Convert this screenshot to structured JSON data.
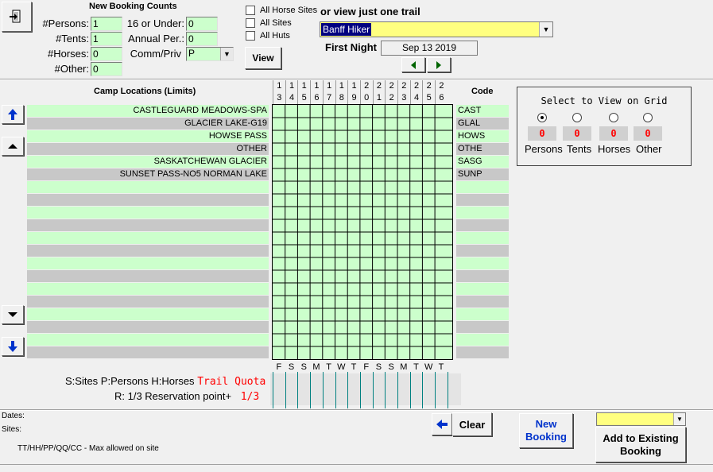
{
  "toolbar": {
    "exit_icon": "exit-door-icon"
  },
  "booking_counts": {
    "title": "New Booking Counts",
    "persons_label": "#Persons:",
    "persons_value": "1",
    "tents_label": "#Tents:",
    "tents_value": "1",
    "horses_label": "#Horses:",
    "horses_value": "0",
    "other_label": "#Other:",
    "other_value": "0",
    "under16_label": "16 or Under:",
    "under16_value": "0",
    "annual_label": "Annual Per.:",
    "annual_value": "0",
    "comm_label": "Comm/Priv",
    "comm_value": "P"
  },
  "filters": {
    "all_horse_sites": "All Horse Sites",
    "all_sites": "All Sites",
    "all_huts": "All Huts",
    "view_button": "View"
  },
  "trail": {
    "title": "or view just one trail",
    "selected": "Banff Hiker",
    "first_night_label": "First Night",
    "first_night_value": "Sep 13 2019"
  },
  "grid": {
    "locations_header": "Camp Locations (Limits)",
    "code_header": "Code",
    "locations": [
      "CASTLEGUARD MEADOWS-SPA",
      "GLACIER LAKE-G19",
      "HOWSE PASS",
      "OTHER",
      "SASKATCHEWAN GLACIER",
      "SUNSET PASS-NO5 NORMAN LAKE"
    ],
    "codes": [
      "CAST",
      "GLAL",
      "HOWS",
      "OTHE",
      "SASG",
      "SUNP"
    ],
    "day_tens": [
      "1",
      "1",
      "1",
      "1",
      "1",
      "1",
      "1",
      "2",
      "2",
      "2",
      "2",
      "2",
      "2",
      "2"
    ],
    "day_ones": [
      "3",
      "4",
      "5",
      "6",
      "7",
      "8",
      "9",
      "0",
      "1",
      "2",
      "3",
      "4",
      "5",
      "6"
    ],
    "weekdays": [
      "F",
      "S",
      "S",
      "M",
      "T",
      "W",
      "T",
      "F",
      "S",
      "S",
      "M",
      "T",
      "W",
      "T"
    ]
  },
  "view_panel": {
    "title": "Select to View on Grid",
    "options": [
      "Persons",
      "Tents",
      "Horses",
      "Other"
    ],
    "counts": [
      "0",
      "0",
      "0",
      "0"
    ]
  },
  "legend": {
    "line1": "S:Sites P:Persons H:Horses",
    "quota": "Trail Quota",
    "line2": "R: 1/3 Reservation point+",
    "ratio": "1/3"
  },
  "footer": {
    "dates_label": "Dates:",
    "sites_label": "Sites:",
    "max_note": "TT/HH/PP/QQ/CC - Max allowed on site",
    "clear_button": "Clear",
    "new_booking_button": "New Booking",
    "add_existing_button": "Add to Existing Booking"
  }
}
